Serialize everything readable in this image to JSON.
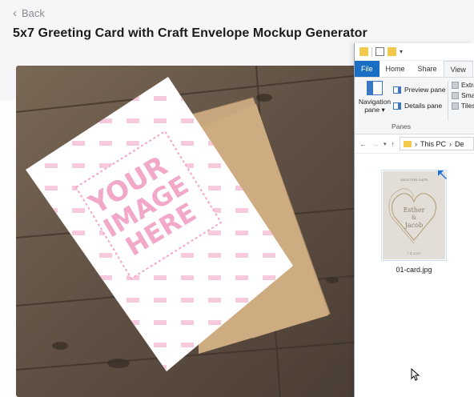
{
  "nav": {
    "back_label": "Back"
  },
  "page": {
    "title": "5x7 Greeting Card with Craft Envelope Mockup Generator"
  },
  "mockup": {
    "card_line1": "YOUR",
    "card_line2": "IMAGE",
    "card_line3": "HERE",
    "colors": {
      "wood": "#6b5a4a",
      "card": "#ffffff",
      "envelope": "#c8a57c",
      "pink": "#f2a8c8"
    }
  },
  "explorer": {
    "tabs": [
      "File",
      "Home",
      "Share",
      "View"
    ],
    "ribbon": {
      "navigation_pane": "Navigation",
      "navigation_pane2": "pane",
      "preview_pane": "Preview pane",
      "details_pane": "Details pane",
      "group_label": "Panes",
      "layout_items": [
        "Extra",
        "Sma",
        "Tiles"
      ]
    },
    "address": {
      "crumb1": "This PC",
      "crumb2": "De"
    },
    "file": {
      "name": "01-card.jpg",
      "thumb_top": "SAVE THE DATE",
      "thumb_name1": "Esther",
      "thumb_amp": "&",
      "thumb_name2": "Jacob",
      "thumb_date": "7.4.2027"
    },
    "colors": {
      "file_tab": "#1a6fc4",
      "selection": "#cfe0f5"
    }
  }
}
